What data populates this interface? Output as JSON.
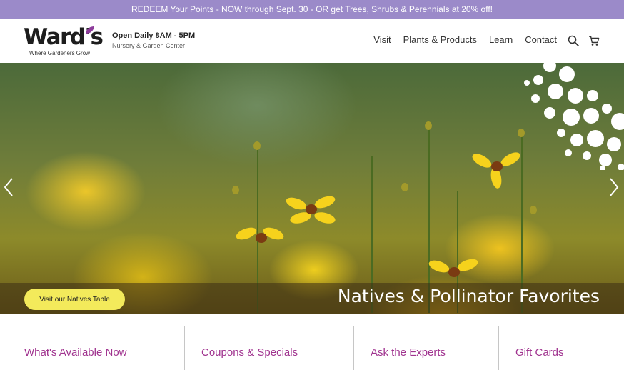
{
  "promo": {
    "text": "REDEEM Your Points - NOW through Sept. 30 - OR get Trees, Shrubs & Perennials at 20% off!",
    "bg_color": "#9b8ac9"
  },
  "header": {
    "logo_text": "Ward's",
    "logo_tagline": "Where Gardeners Grow",
    "hours_main": "Open Daily 8AM - 5PM",
    "hours_sub": "Nursery & Garden Center",
    "nav": [
      "Visit",
      "Plants & Products",
      "Learn",
      "Contact"
    ],
    "icons": [
      "search-icon",
      "cart-icon"
    ]
  },
  "hero": {
    "button_label": "Visit our Natives Table",
    "title": "Natives & Pollinator Favorites",
    "button_color": "#f3ea5b",
    "icons": [
      "chevron-left-icon",
      "chevron-right-icon"
    ]
  },
  "quick_links": [
    "What's Available Now",
    "Coupons & Specials",
    "Ask the Experts",
    "Gift Cards"
  ],
  "colors": {
    "accent_link": "#a0338f",
    "logo_leaf": "#8d3c9b"
  }
}
